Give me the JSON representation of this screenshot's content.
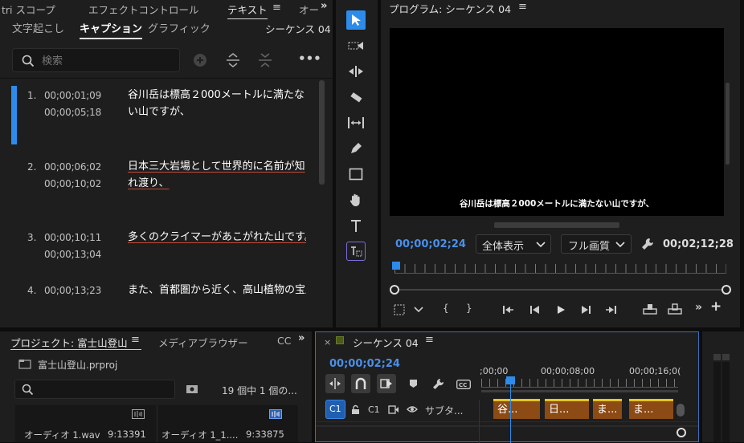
{
  "text_panel": {
    "tabs": [
      "tri スコープ",
      "エフェクトコントロール",
      "テキスト",
      "オー"
    ],
    "subtabs": [
      "文字起こし",
      "キャプション",
      "グラフィック"
    ],
    "sequence_label": "シーケンス 04",
    "search_placeholder": "検索",
    "captions": [
      {
        "num": "1.",
        "tc_in": "00;00;01;09",
        "tc_out": "00;00;05;18",
        "text": "谷川岳は標高２000メートルに満たない山ですが、"
      },
      {
        "num": "2.",
        "tc_in": "00;00;06;02",
        "tc_out": "00;00;10;02",
        "text": "日本三大岩場として世界的に名前が知れ渡り、"
      },
      {
        "num": "3.",
        "tc_in": "00;00;10;11",
        "tc_out": "00;00;13;04",
        "text": "多くのクライマーがあこがれた山です。"
      },
      {
        "num": "4.",
        "tc_in": "00;00;13;23",
        "tc_out": "",
        "text": "また、首都圏から近く、高山植物の宝庫"
      }
    ]
  },
  "tools": [
    "selection-tool",
    "track-select-tool",
    "ripple-edit-tool",
    "razor-tool",
    "slip-tool",
    "pen-tool",
    "rectangle-tool",
    "hand-tool",
    "type-tool",
    "caption-tool"
  ],
  "program": {
    "title": "プログラム: シーケンス 04",
    "subtitle": "谷川岳は標高２000メートルに満たない山ですが、",
    "timecode": "00;00;02;24",
    "fit": "全体表示",
    "quality": "フル画質",
    "duration": "00;02;12;28"
  },
  "project": {
    "tab": "プロジェクト: 富士山登山",
    "tab2": "メディアブラウザー",
    "tab3": "CC",
    "file": "富士山登山.prproj",
    "count": "19 個中 1 個の...",
    "items": [
      {
        "name": "オーディオ 1.wav",
        "duration": "9:13391"
      },
      {
        "name": "オーディオ 1_1....",
        "duration": "9:33875"
      }
    ]
  },
  "timeline": {
    "title": "シーケンス 04",
    "timecode": "00;00;02;24",
    "ruler": [
      ";00;00",
      "00;00;08;00",
      "00;00;16;0("
    ],
    "track_target": "C1",
    "track_name": "C1",
    "track_label": "サブタ...",
    "clips": [
      "谷...",
      "日...",
      "ま...",
      "ま..."
    ]
  },
  "colors": {
    "accent": "#2d8ceb",
    "clip": "#8c4a14",
    "clip_top": "#e8c51a"
  }
}
